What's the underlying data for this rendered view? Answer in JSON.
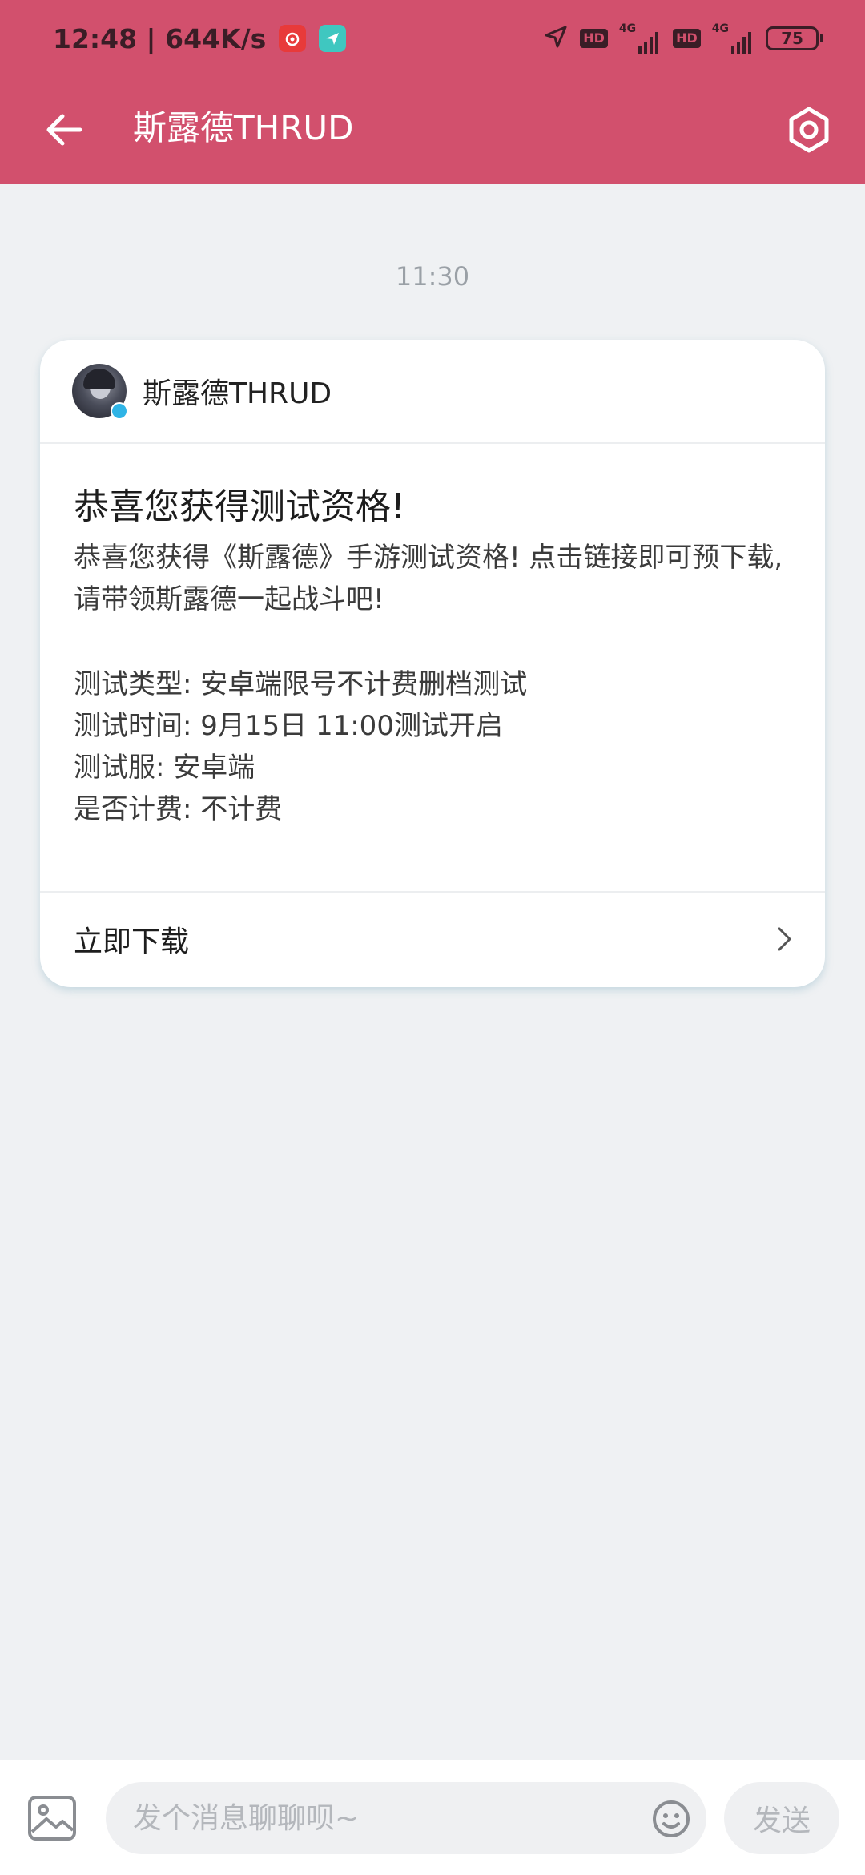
{
  "status_bar": {
    "time": "12:48",
    "separator": "|",
    "net_speed": "644K/s",
    "battery": "75",
    "network_type": "4G",
    "hd_label": "HD"
  },
  "header": {
    "title": "斯露德THRUD"
  },
  "chat": {
    "timestamp": "11:30"
  },
  "card": {
    "sender": "斯露德THRUD",
    "title": "恭喜您获得测试资格!",
    "intro": "恭喜您获得《斯露德》手游测试资格! 点击链接即可预下载, 请带领斯露德一起战斗吧!",
    "details": [
      "测试类型: 安卓端限号不计费删档测试",
      "测试时间: 9月15日 11:00测试开启",
      "测试服: 安卓端",
      "是否计费: 不计费"
    ],
    "action_label": "立即下载"
  },
  "input_bar": {
    "placeholder": "发个消息聊聊呗~",
    "send_label": "发送"
  },
  "colors": {
    "header_bg": "#d2506d",
    "page_bg": "#eff1f3",
    "card_bg": "#ffffff"
  },
  "icons": [
    "back-arrow-icon",
    "settings-hexagon-icon",
    "image-icon",
    "emoji-icon",
    "chevron-right-icon",
    "location-arrow-icon",
    "signal-icon"
  ]
}
